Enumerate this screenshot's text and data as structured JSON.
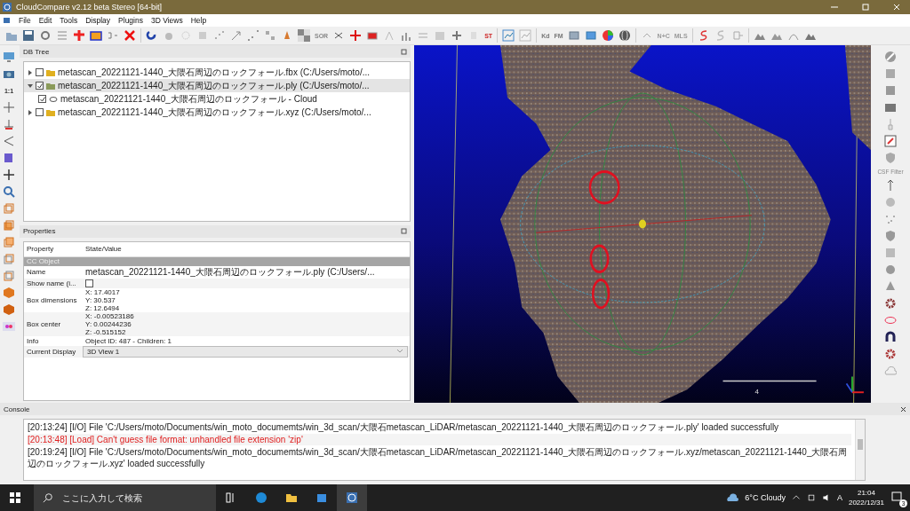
{
  "window": {
    "title": "CloudCompare v2.12 beta Stereo [64-bit]"
  },
  "menu": [
    "File",
    "Edit",
    "Tools",
    "Display",
    "Plugins",
    "3D Views",
    "Help"
  ],
  "toolbar_texts": [
    "SOR",
    "ST",
    "Kd",
    "FM",
    "N+C",
    "MLS"
  ],
  "left_toolbar_texts": [
    "1:1"
  ],
  "right_toolbar_texts": [
    "CSF Filter"
  ],
  "db_tree": {
    "title": "DB Tree",
    "items": [
      {
        "label": "metascan_20221121-1440_大隈石周辺のロックフォール.fbx (C:/Users/moto/...",
        "expanded": false,
        "checked": false,
        "selected": false
      },
      {
        "label": "metascan_20221121-1440_大隈石周辺のロックフォール.ply (C:/Users/moto/...",
        "expanded": true,
        "checked": true,
        "selected": true,
        "children": [
          {
            "label": "metascan_20221121-1440_大隈石周辺のロックフォール - Cloud",
            "checked": true,
            "selected": false
          }
        ]
      },
      {
        "label": "metascan_20221121-1440_大隈石周辺のロックフォール.xyz (C:/Users/moto/...",
        "expanded": false,
        "checked": false,
        "selected": false
      }
    ]
  },
  "properties": {
    "title": "Properties",
    "columns": [
      "Property",
      "State/Value"
    ],
    "section": "CC Object",
    "rows": [
      {
        "kind": "text",
        "name": "Name",
        "values": [
          "metascan_20221121-1440_大隈石周辺のロックフォール.ply (C:/Users/..."
        ]
      },
      {
        "kind": "checkbox",
        "name": "Show name (i...",
        "checked": false
      },
      {
        "kind": "text",
        "name": "Box dimensions",
        "values": [
          "X: 17.4017",
          "Y: 30.537",
          "Z: 12.6494"
        ]
      },
      {
        "kind": "text",
        "name": "Box center",
        "values": [
          "X: -0.00523186",
          "Y: 0.00244236",
          "Z: -0.515152"
        ]
      },
      {
        "kind": "text",
        "name": "Info",
        "values": [
          "Object ID: 487 - Children: 1"
        ]
      },
      {
        "kind": "dropdown",
        "name": "Current Display",
        "values": [
          "3D View 1"
        ]
      }
    ]
  },
  "viewport": {
    "scale_label": "4"
  },
  "console": {
    "title": "Console",
    "lines": [
      {
        "kind": "info",
        "text": "[20:13:24] [I/O] File 'C:/Users/moto/Documents/win_moto_documemts/win_3d_scan/大隈石metascan_LiDAR/metascan_20221121-1440_大隈石周辺のロックフォール.ply' loaded successfully"
      },
      {
        "kind": "error",
        "text": "[20:13:48] [Load] Can't guess file format: unhandled file extension 'zip'"
      },
      {
        "kind": "info",
        "text": "[20:19:24] [I/O] File 'C:/Users/moto/Documents/win_moto_documemts/win_3d_scan/大隈石metascan_LiDAR/metascan_20221121-1440_大隈石周辺のロックフォール.xyz/metascan_20221121-1440_大隈石周辺のロックフォール.xyz' loaded successfully"
      }
    ]
  },
  "taskbar": {
    "search": {
      "placeholder": "ここに入力して検索"
    },
    "weather": "6°C  Cloudy",
    "ime": "A",
    "time": "21:04",
    "date": "2022/12/31",
    "notifications": "3"
  }
}
